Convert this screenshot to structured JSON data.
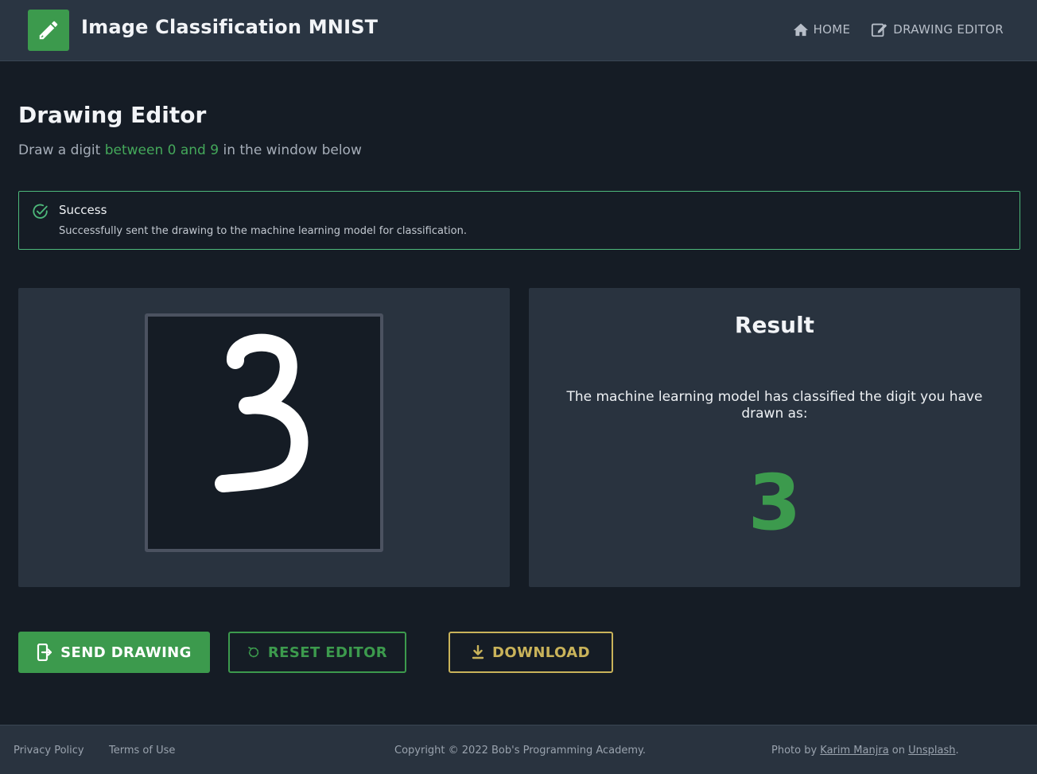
{
  "header": {
    "logo_icon": "pencil-icon",
    "title": "Image Classification MNIST",
    "nav": [
      {
        "label": "HOME",
        "icon": "home-icon"
      },
      {
        "label": "DRAWING EDITOR",
        "icon": "edit-icon"
      }
    ]
  },
  "page": {
    "title": "Drawing Editor",
    "subtitle_pre": "Draw a digit ",
    "subtitle_highlight": "between 0 and 9",
    "subtitle_post": " in the window below"
  },
  "alert": {
    "icon": "check-circle-icon",
    "title": "Success",
    "message": "Successfully sent the drawing to the machine learning model for classification."
  },
  "editor": {
    "drawn_digit": "3"
  },
  "result": {
    "title": "Result",
    "text": "The machine learning model has classified the digit you have drawn as:",
    "digit": "3"
  },
  "buttons": {
    "send": {
      "label": "SEND DRAWING",
      "icon": "send-icon"
    },
    "reset": {
      "label": "RESET EDITOR",
      "icon": "reset-icon"
    },
    "download": {
      "label": "DOWNLOAD",
      "icon": "download-icon"
    }
  },
  "footer": {
    "privacy": "Privacy Policy",
    "terms": "Terms of Use",
    "copyright": "Copyright © 2022 Bob's Programming Academy.",
    "photo_by": "Photo by ",
    "photographer": "Karim Manjra",
    "on": " on ",
    "site": "Unsplash",
    "period": "."
  },
  "colors": {
    "accent": "#3c9a4d",
    "warning": "#c9b35a",
    "background": "#151c25",
    "panel": "#29333f"
  }
}
